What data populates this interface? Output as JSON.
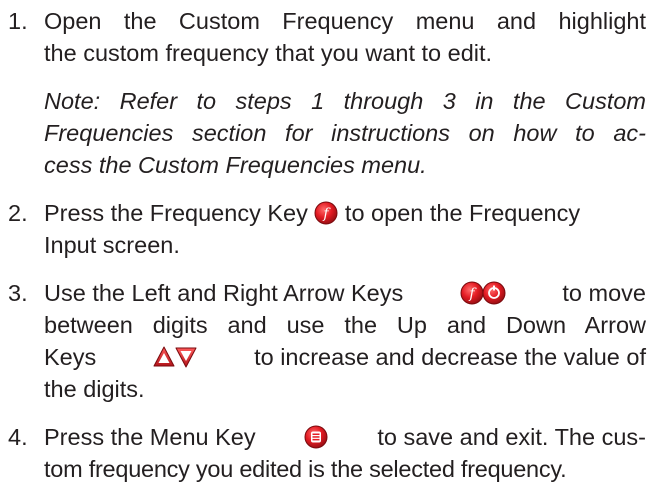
{
  "steps": [
    {
      "number": "1.",
      "lines": [
        "Open the Custom Frequency menu and highlight",
        "the custom frequency that you want to edit."
      ]
    },
    {
      "number": "2.",
      "lines": [
        "Press the Frequency Key",
        "to open the Frequency",
        "Input screen."
      ]
    },
    {
      "number": "3.",
      "lines": [
        "Use the Left and Right Arrow Keys",
        "to move",
        "between digits and use the Up and Down Arrow",
        "Keys",
        "to increase and decrease the value of",
        "the digits."
      ]
    },
    {
      "number": "4.",
      "lines": [
        "Press the Menu Key",
        "to save and exit. The cus-",
        "tom frequency you edited is the selected frequency."
      ]
    }
  ],
  "note": {
    "lines": [
      "Note: Refer to steps 1 through 3 in the Custom",
      "Frequencies section for instructions on how to ac-",
      "cess the Custom Frequencies menu."
    ]
  },
  "icons": {
    "frequency_key": "frequency-key-icon",
    "left_right_keys": "left-right-arrow-keys-icon",
    "up_down_keys": "up-down-arrow-keys-icon",
    "menu_key": "menu-key-icon"
  },
  "colors": {
    "key_red": "#e31b23",
    "text": "#231f20"
  }
}
